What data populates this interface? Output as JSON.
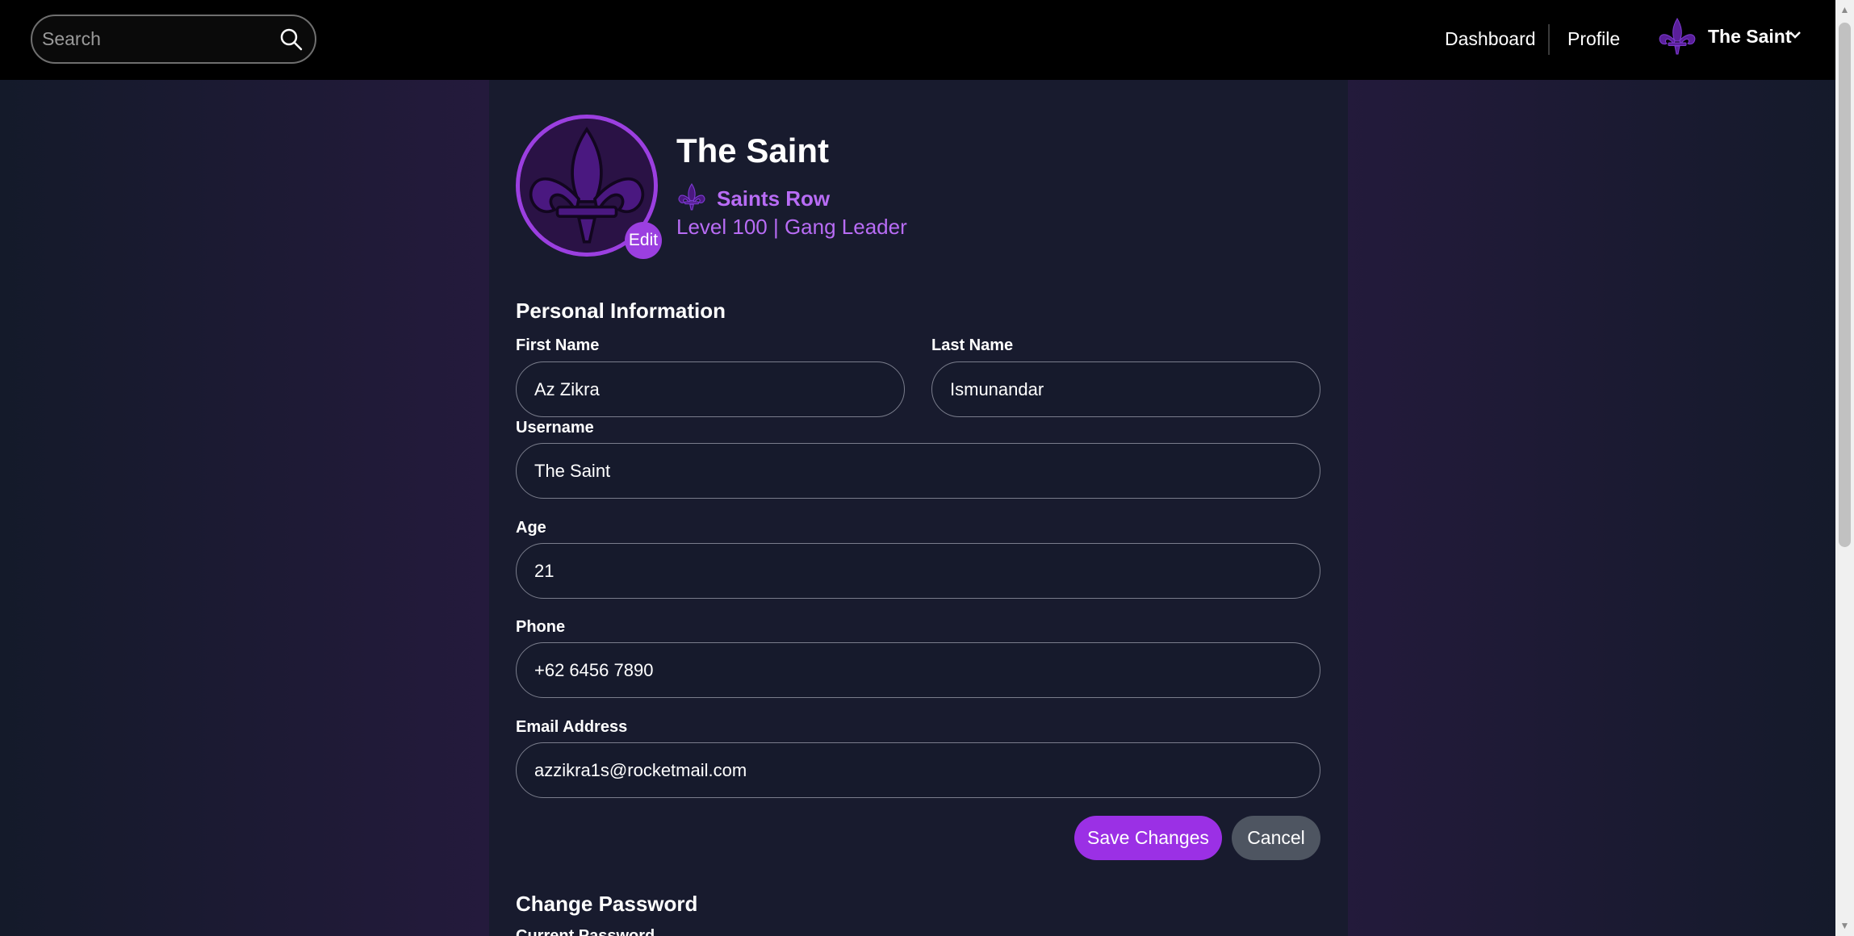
{
  "nav": {
    "search_placeholder": "Search",
    "links": [
      "Dashboard",
      "Profile"
    ],
    "user_name": "The Saint"
  },
  "profile": {
    "name": "The Saint",
    "gang": "Saints Row",
    "level_text": "Level 100 | Gang Leader",
    "edit_label": "Edit"
  },
  "personal": {
    "title": "Personal Information",
    "first_name_label": "First Name",
    "first_name": "Az Zikra",
    "last_name_label": "Last Name",
    "last_name": "Ismunandar",
    "username_label": "Username",
    "username": "The Saint",
    "age_label": "Age",
    "age": "21",
    "phone_label": "Phone",
    "phone": "+62 6456 7890",
    "email_label": "Email Address",
    "email": "azzikra1s@rocketmail.com",
    "save_label": "Save Changes",
    "cancel_label": "Cancel"
  },
  "password": {
    "title": "Change Password",
    "current_label": "Current Password"
  },
  "colors": {
    "accent": "#9b30e5",
    "accent_text": "#b86cf5",
    "panel": "#181b2e",
    "topbar": "#000000"
  },
  "icons": [
    "search-icon",
    "fleur-de-lis-logo",
    "chevron-down-icon"
  ]
}
